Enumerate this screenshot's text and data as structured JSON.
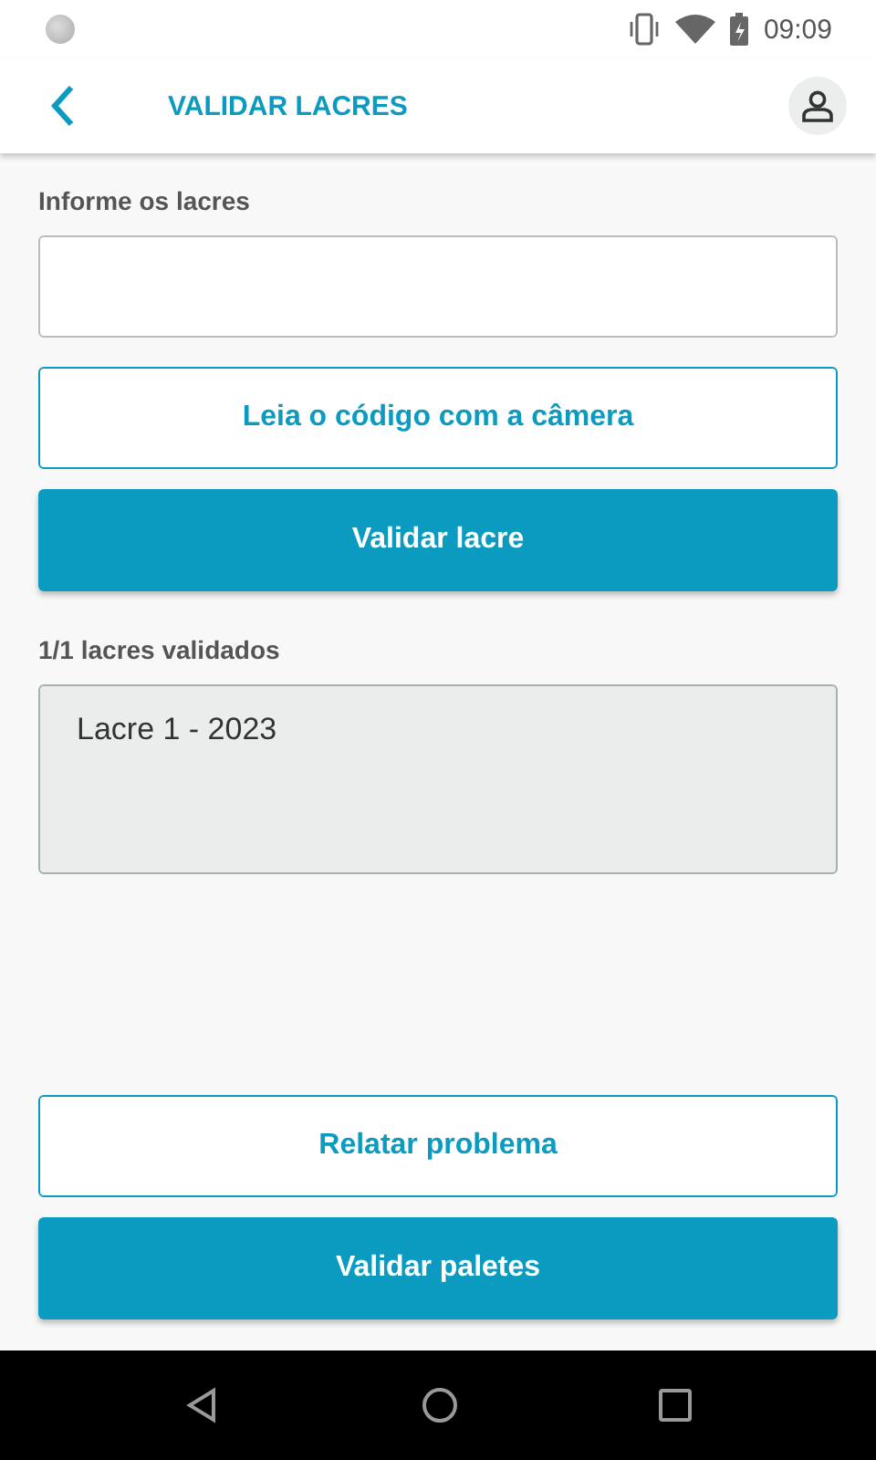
{
  "status_bar": {
    "time": "09:09"
  },
  "header": {
    "title": "VALIDAR LACRES"
  },
  "input": {
    "label": "Informe os lacres"
  },
  "actions": [
    {
      "label": "Leia o código com a câmera",
      "kind": "outline"
    },
    {
      "label": "Validar lacre",
      "kind": "filled"
    }
  ],
  "validated": {
    "count": "1/1 lacres validados",
    "items": [
      "Lacre 1 - 2023"
    ]
  },
  "footer_actions": [
    {
      "label": "Relatar problema",
      "kind": "outline"
    },
    {
      "label": "Validar paletes",
      "kind": "filled"
    }
  ]
}
